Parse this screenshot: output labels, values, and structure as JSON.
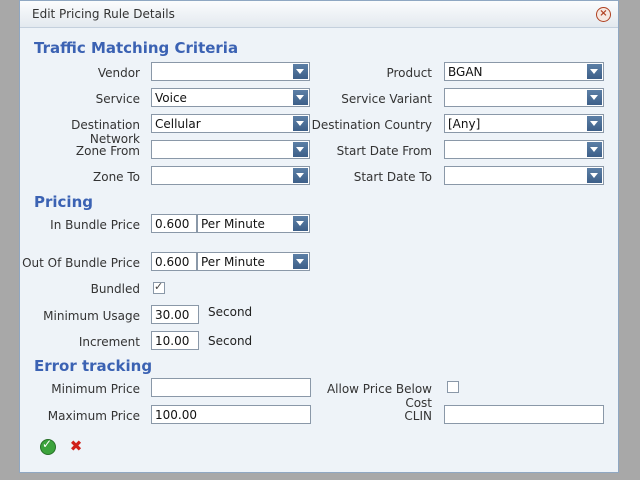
{
  "dialog": {
    "title": "Edit Pricing Rule Details"
  },
  "sections": {
    "traffic": "Traffic Matching Criteria",
    "pricing": "Pricing",
    "error": "Error tracking"
  },
  "traffic": {
    "vendor": {
      "label": "Vendor",
      "value": ""
    },
    "product": {
      "label": "Product",
      "value": "BGAN"
    },
    "service": {
      "label": "Service",
      "value": "Voice"
    },
    "service_variant": {
      "label": "Service Variant",
      "value": ""
    },
    "destination_network": {
      "label": "Destination Network",
      "value": "Cellular"
    },
    "destination_country": {
      "label": "Destination Country",
      "value": "[Any]"
    },
    "zone_from": {
      "label": "Zone From",
      "value": ""
    },
    "start_date_from": {
      "label": "Start Date From",
      "value": ""
    },
    "zone_to": {
      "label": "Zone To",
      "value": ""
    },
    "start_date_to": {
      "label": "Start Date To",
      "value": ""
    }
  },
  "pricing": {
    "in_bundle": {
      "label": "In Bundle Price",
      "price": "0.600",
      "unit": "Per Minute"
    },
    "out_of_bundle": {
      "label": "Out Of Bundle Price",
      "price": "0.600",
      "unit": "Per Minute"
    },
    "bundled": {
      "label": "Bundled",
      "checked": true,
      "mark": "✓"
    },
    "minimum_usage": {
      "label": "Minimum Usage",
      "value": "30.00",
      "unit": "Second"
    },
    "increment": {
      "label": "Increment",
      "value": "10.00",
      "unit": "Second"
    }
  },
  "error_tracking": {
    "minimum_price": {
      "label": "Minimum Price",
      "value": ""
    },
    "allow_price_below_cost": {
      "label": "Allow Price Below Cost",
      "checked": false
    },
    "maximum_price": {
      "label": "Maximum Price",
      "value": "100.00"
    },
    "clin": {
      "label": "CLIN",
      "value": ""
    }
  },
  "actions": {
    "ok_icon": "checkmark-icon",
    "cancel_icon": "cross-icon",
    "ok_glyph": "✓",
    "cancel_glyph": "✖"
  },
  "colors": {
    "section_heading": "#3b62b3",
    "arrow_button": "#4a6d96",
    "ok": "#3ca33c",
    "cancel": "#d0201a"
  }
}
